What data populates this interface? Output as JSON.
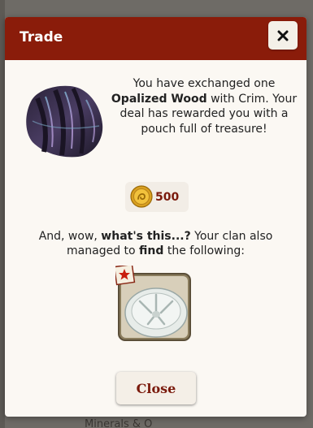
{
  "background": {
    "bottom_text": "Minerals & O"
  },
  "dialog": {
    "title": "Trade",
    "message_part1": "You have exchanged one ",
    "item_name": "Opalized Wood",
    "message_part2": " with Crim. Your deal has rewarded you with a pouch full of treasure!",
    "reward_amount": "500",
    "find_part1": "And, wow, ",
    "find_highlight1": "what's this...?",
    "find_part2": " Your clan also managed to ",
    "find_highlight2": "find",
    "find_part3": " the following:",
    "close_label": "Close",
    "item_icon": "opalized-wood-icon",
    "found_icon": "sand-dollar-icon",
    "coin_icon": "gold-coin-icon",
    "close_icon": "close-icon"
  },
  "colors": {
    "header": "#8a1c0a",
    "dialog_bg": "#fbf8f3",
    "accent_text": "#7a1a0c"
  }
}
